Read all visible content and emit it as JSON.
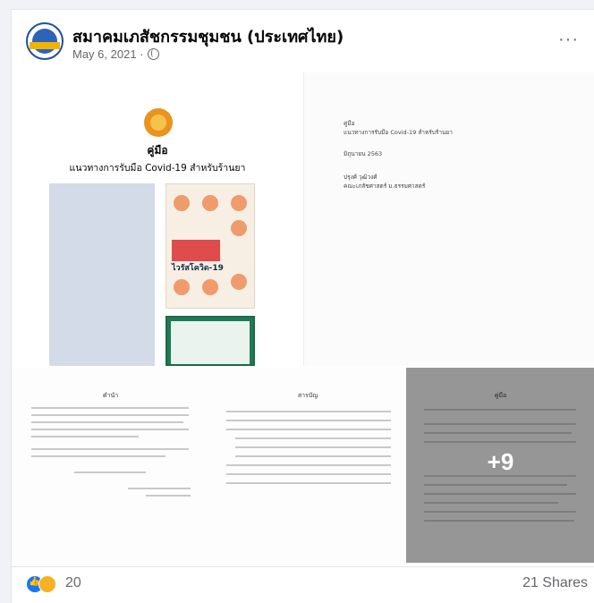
{
  "post": {
    "page_name": "สมาคมเภสัชกรรมชุมชน (ประเทศไทย)",
    "date": "May 6, 2021 ·",
    "more_label": "···",
    "privacy_icon": "globe-icon"
  },
  "document": {
    "cover_heading": "คู่มือ",
    "cover_subtitle": "แนวทางการรับมือ Covid-19 สำหรับร้านยา",
    "poster_title": "ไวรัสโควิด-19",
    "info_lines": [
      "คู่มือ",
      "แนวทางการรับมือ Covid-19 สำหรับร้านยา",
      "มิถุนายน 2563",
      "ปรุงศ์ วุฒิวงศ์",
      "คณะเภสัชศาสตร์ ม.ธรรมศาสตร์"
    ],
    "page3_title": "คำนำ",
    "page4_title": "สารบัญ",
    "page5_title": "คู่มือ"
  },
  "photos": {
    "more_count": "+9"
  },
  "reactions": {
    "count": "20",
    "shares": "21 Shares"
  },
  "colors": {
    "accent": "#1877f2",
    "secondary_text": "#65676b"
  }
}
